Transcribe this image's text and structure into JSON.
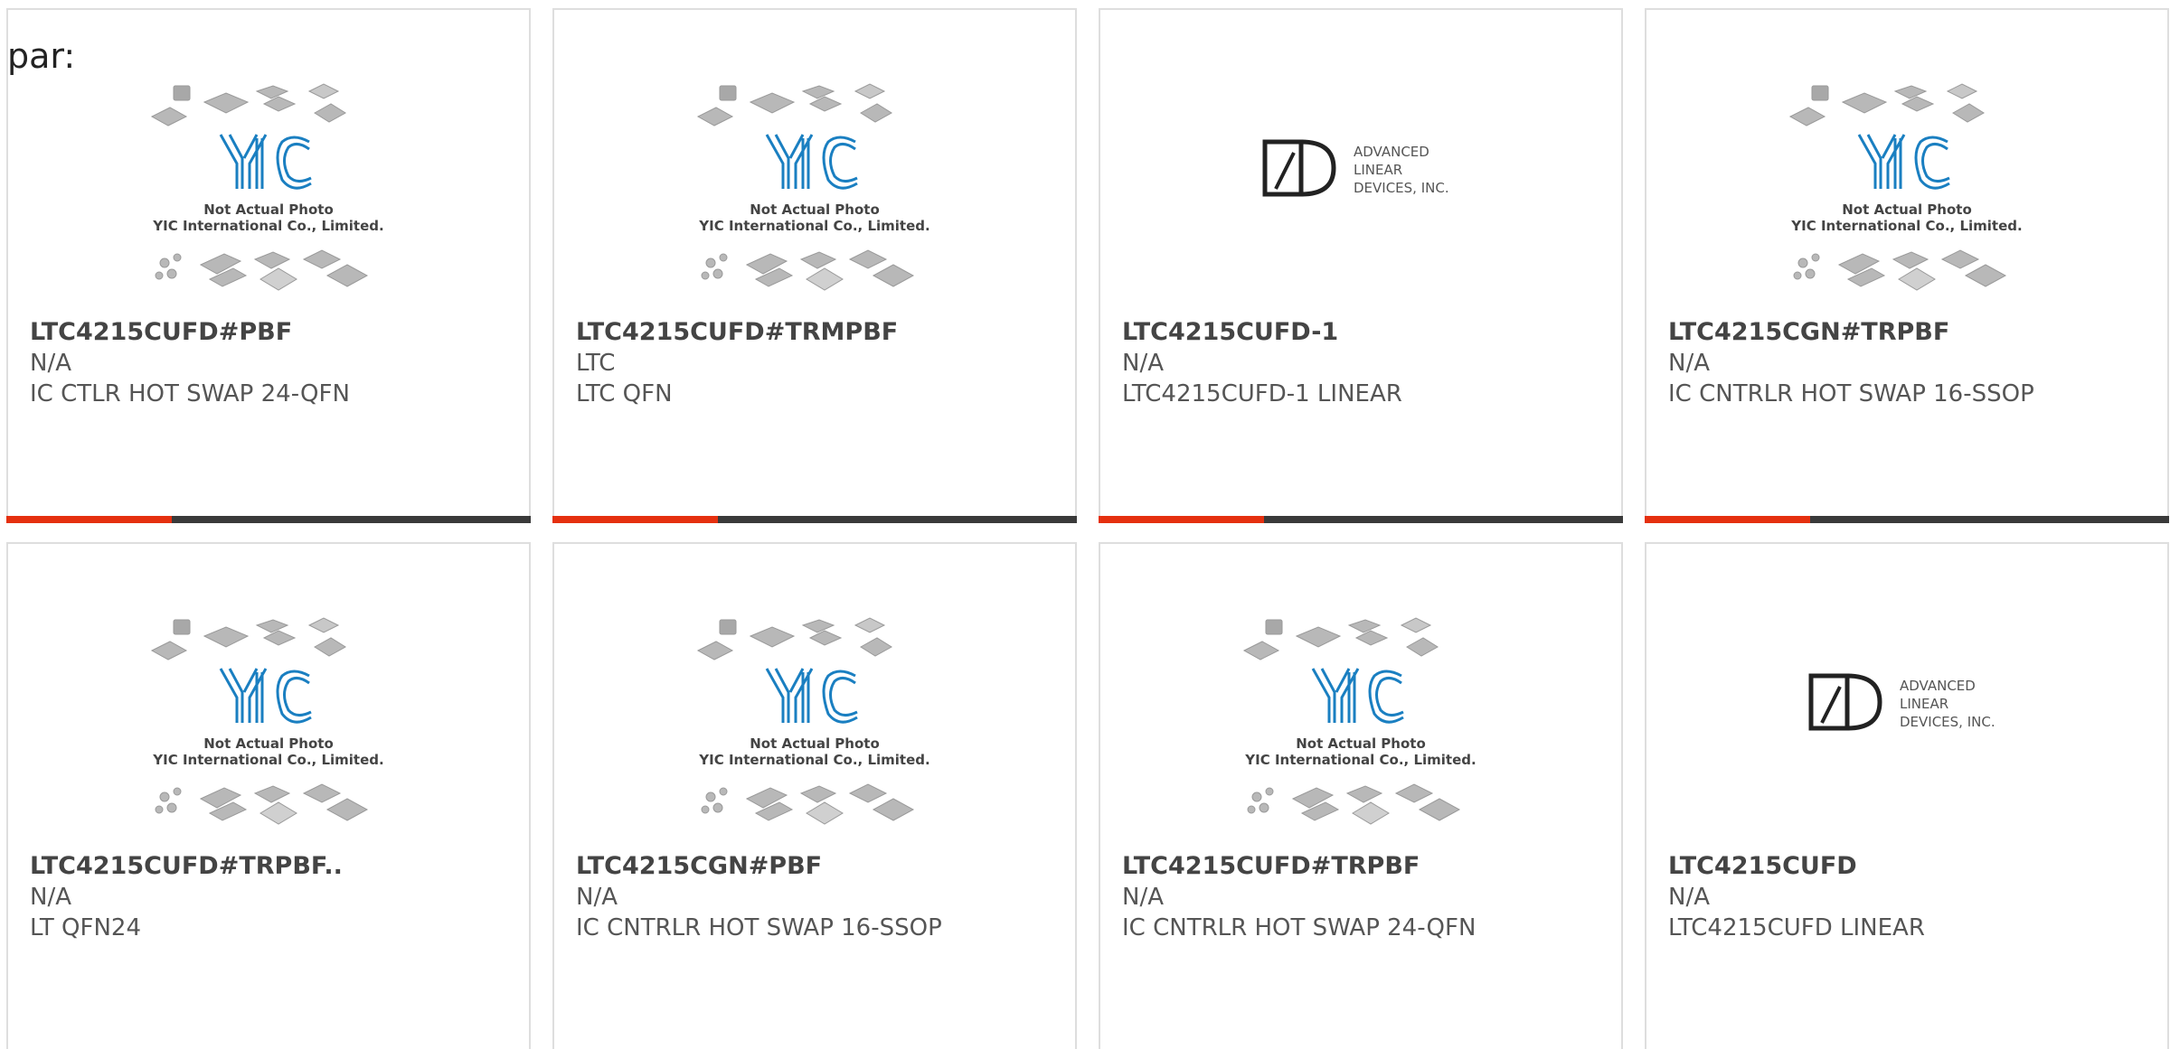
{
  "header": {
    "label": "par:"
  },
  "cards": [
    {
      "part_number": "LTC4215CUFD#PBF",
      "manufacturer": "N/A",
      "description": "IC CTLR HOT SWAP 24-QFN",
      "image": "yic",
      "show_bar": true
    },
    {
      "part_number": "LTC4215CUFD#TRMPBF",
      "manufacturer": "LTC",
      "description": "LTC QFN",
      "image": "yic",
      "show_bar": true
    },
    {
      "part_number": "LTC4215CUFD-1",
      "manufacturer": "N/A",
      "description": "LTC4215CUFD-1 LINEAR",
      "image": "ald",
      "show_bar": true
    },
    {
      "part_number": "LTC4215CGN#TRPBF",
      "manufacturer": "N/A",
      "description": "IC CNTRLR HOT SWAP 16-SSOP",
      "image": "yic",
      "show_bar": true
    },
    {
      "part_number": "LTC4215CUFD#TRPBF..",
      "manufacturer": "N/A",
      "description": "LT QFN24",
      "image": "yic",
      "show_bar": false
    },
    {
      "part_number": "LTC4215CGN#PBF",
      "manufacturer": "N/A",
      "description": "IC CNTRLR HOT SWAP 16-SSOP",
      "image": "yic",
      "show_bar": false
    },
    {
      "part_number": "LTC4215CUFD#TRPBF",
      "manufacturer": "N/A",
      "description": "IC CNTRLR HOT SWAP 24-QFN",
      "image": "yic",
      "show_bar": false
    },
    {
      "part_number": "LTC4215CUFD",
      "manufacturer": "N/A",
      "description": "LTC4215CUFD LINEAR",
      "image": "ald",
      "show_bar": false
    }
  ],
  "yic_placeholder": {
    "line1": "Not Actual Photo",
    "line2": "YIC International Co., Limited."
  },
  "ald_logo": {
    "line1": "ADVANCED",
    "line2": "LINEAR",
    "line3": "DEVICES, INC."
  },
  "colors": {
    "accent": "#e5300f",
    "bar": "#3a3a3a",
    "yic_blue": "#1a7fc1"
  }
}
